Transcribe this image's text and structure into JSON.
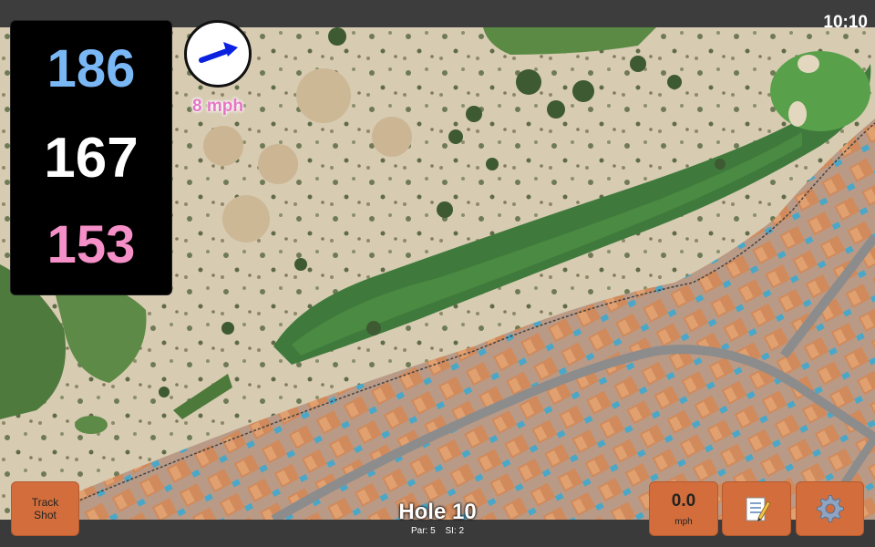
{
  "status": {
    "clock": "10:10"
  },
  "distances": {
    "back": "186",
    "middle": "167",
    "front": "153"
  },
  "wind": {
    "speed_label": "8 mph",
    "arrow_icon": "wind-direction-arrow-icon"
  },
  "buttons": {
    "track_shot_line1": "Track",
    "track_shot_line2": "Shot",
    "speed_value": "0.0",
    "speed_unit": "mph",
    "notes_icon": "notepad-icon",
    "settings_icon": "gear-icon"
  },
  "hole": {
    "title": "Hole 10",
    "par": "Par: 5",
    "si": "SI: 2"
  },
  "colors": {
    "back": "#7ab7f5",
    "middle": "#ffffff",
    "front": "#f58fc8",
    "button": "#d36e3c",
    "wind_text": "#e676c4"
  }
}
